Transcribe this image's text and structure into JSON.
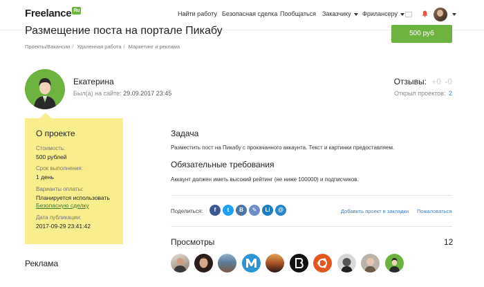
{
  "header": {
    "logo_text": "Freelance",
    "logo_badge": "Ru",
    "nav": [
      "Найти работу",
      "Безопасная сделка",
      "Пообщаться",
      "Заказчику",
      "Фрилансеру"
    ]
  },
  "project": {
    "title": "Размещение поста на портале Пикабу",
    "budget": "500 руб",
    "breadcrumbs": [
      "Проекты/Вакансии",
      "Удаленная работа",
      "Маркетинг и реклама"
    ]
  },
  "customer": {
    "name": "Екатерина",
    "seen_label": "Был(а) на сайте:",
    "seen_value": "29.09.2017 23:45",
    "reviews_label": "Отзывы:",
    "reviews_plus": "+0",
    "reviews_minus": "-0",
    "opened_label": "Открыл проектов:",
    "opened_value": "2"
  },
  "about": {
    "title": "О проекте",
    "cost_label": "Стоимость:",
    "cost_value": "500 рублей",
    "term_label": "Срок выполнения:",
    "term_value": "1 день",
    "payment_label": "Варианты оплаты:",
    "payment_value": "Планируется использовать",
    "payment_link": "Безопасную сделку",
    "published_label": "Дата публикации:",
    "published_value": "2017-09-29 23:41:42"
  },
  "ads_title": "Реклама",
  "task": {
    "title": "Задача",
    "text": "Разместить пост на Пикабу с прокачанного аккаунта. Текст и картинки предоставляем.",
    "req_title": "Обязательные требования",
    "req_text": "Аккаунт должен иметь высокий рейтинг (не ниже 100000) и подписчиков."
  },
  "share": {
    "label": "Поделиться:",
    "networks": [
      {
        "icon": "facebook-icon",
        "glyph": "f",
        "color": "#3b5998"
      },
      {
        "icon": "twitter-icon",
        "glyph": "t",
        "color": "#1da1f2"
      },
      {
        "icon": "vkontakte-icon",
        "glyph": "B",
        "color": "#4c75a3"
      },
      {
        "icon": "livejournal-icon",
        "glyph": "✎",
        "color": "#6d8fc7"
      },
      {
        "icon": "linkedin-icon",
        "glyph": "Li",
        "color": "#1b7dc4"
      },
      {
        "icon": "email-icon",
        "glyph": "@",
        "color": "#2a85c9"
      }
    ],
    "bookmark": "Добавить проект в закладки",
    "complain": "Пожаловаться"
  },
  "views": {
    "title": "Просмотры",
    "count": "12"
  }
}
